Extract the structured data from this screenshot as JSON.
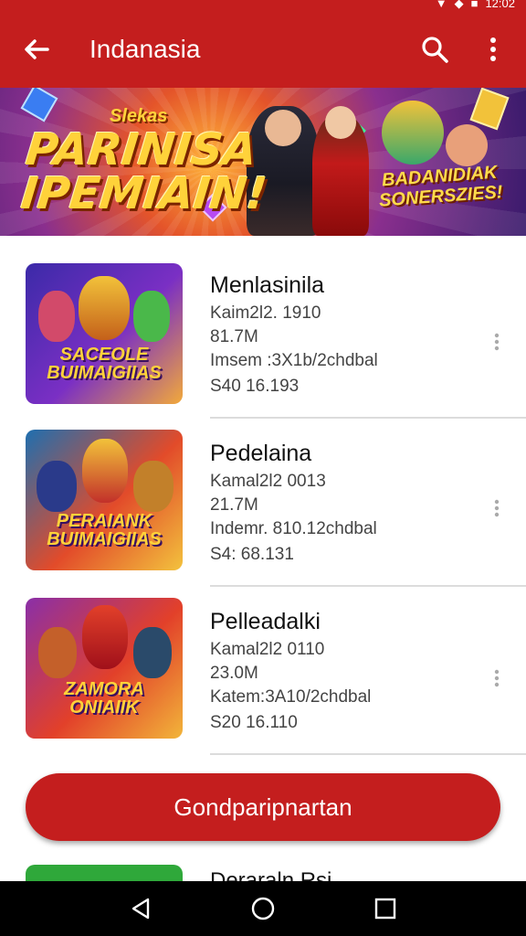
{
  "status_bar": {
    "time": "12:02"
  },
  "app_bar": {
    "title": "Indanasia"
  },
  "banner": {
    "top_text": "Slekas",
    "title_line1": "PARINISA",
    "title_line2": "IPEMIAIN!",
    "tag_line1": "BADANIDIAK",
    "tag_line2": "SONERSZIES!"
  },
  "games": [
    {
      "name": "Menlasinila",
      "line1": "Kaim2l2. 1910",
      "line2": "81.7M",
      "line3": "Imsem :3X1b/2chdbal",
      "line4": "S40 16.193",
      "thumb_label": "SACEOLE BUIMAIGIIAS",
      "thumb_colors": [
        "#3b2aa8",
        "#7a2fc4",
        "#f2a93a"
      ]
    },
    {
      "name": "Pedelaina",
      "line1": "Kamal2l2 0013",
      "line2": "21.7M",
      "line3": "Indemr. 810.12chdbal",
      "line4": "S4: 68.131",
      "thumb_label": "PERAIANK BUIMAIGIIAS",
      "thumb_colors": [
        "#1e6fb0",
        "#e24b2a",
        "#f3c23d"
      ]
    },
    {
      "name": "Pelleadalki",
      "line1": "Kamal2l2 0110",
      "line2": "23.0M",
      "line3": "Katem:3A10/2chdbal",
      "line4": "S20 16.110",
      "thumb_label": "ZAMORA ONIAIIK",
      "thumb_colors": [
        "#8a2fa8",
        "#e2402a",
        "#f2b53a"
      ]
    }
  ],
  "cta": {
    "label": "Gondparipnartan"
  },
  "peek": {
    "name": "Deraraln Rsi"
  },
  "icons": {
    "back": "arrow-left-icon",
    "search": "search-icon",
    "more": "more-vertical-icon",
    "nav_back": "triangle-back-icon",
    "nav_home": "circle-home-icon",
    "nav_recent": "square-recent-icon"
  },
  "colors": {
    "primary": "#c41e1e",
    "nav": "#000000",
    "list_bg": "#ffffff"
  }
}
